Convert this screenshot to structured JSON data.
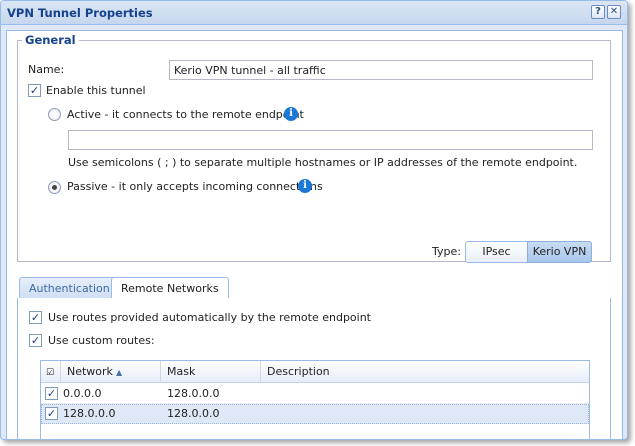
{
  "window": {
    "title": "VPN Tunnel Properties",
    "help_glyph": "?",
    "close_glyph": "✕"
  },
  "general": {
    "legend": "General",
    "name_label": "Name:",
    "name_value": "Kerio VPN tunnel - all traffic",
    "enable_label": "Enable this tunnel",
    "enable_checked": true,
    "active_label": "Active - it connects to the remote endpoint",
    "active_selected": false,
    "remote_endpoint_value": "",
    "hint": "Use semicolons ( ; ) to separate multiple hostnames or IP addresses of the remote endpoint.",
    "passive_label": "Passive - it only accepts incoming connections",
    "passive_selected": true,
    "info_glyph": "i",
    "type_label": "Type:",
    "type_options": [
      "IPsec",
      "Kerio VPN"
    ],
    "type_selected": "Kerio VPN"
  },
  "tabs": [
    {
      "label": "Authentication",
      "active": false
    },
    {
      "label": "Remote Networks",
      "active": true
    }
  ],
  "remote_networks": {
    "auto_routes_label": "Use routes provided automatically by the remote endpoint",
    "auto_routes_checked": true,
    "custom_routes_label": "Use custom routes:",
    "custom_routes_checked": true,
    "columns": [
      "Network",
      "Mask",
      "Description"
    ],
    "sorted_column": "Network",
    "rows": [
      {
        "checked": true,
        "network": "0.0.0.0",
        "mask": "128.0.0.0",
        "description": "",
        "selected": false
      },
      {
        "checked": true,
        "network": "128.0.0.0",
        "mask": "128.0.0.0",
        "description": "",
        "selected": true
      }
    ]
  },
  "colors": {
    "title_text": "#15428b",
    "border_blue": "#99bbe8",
    "panel_bg": "#dfe8f6",
    "info_blue": "#1b78d6"
  }
}
